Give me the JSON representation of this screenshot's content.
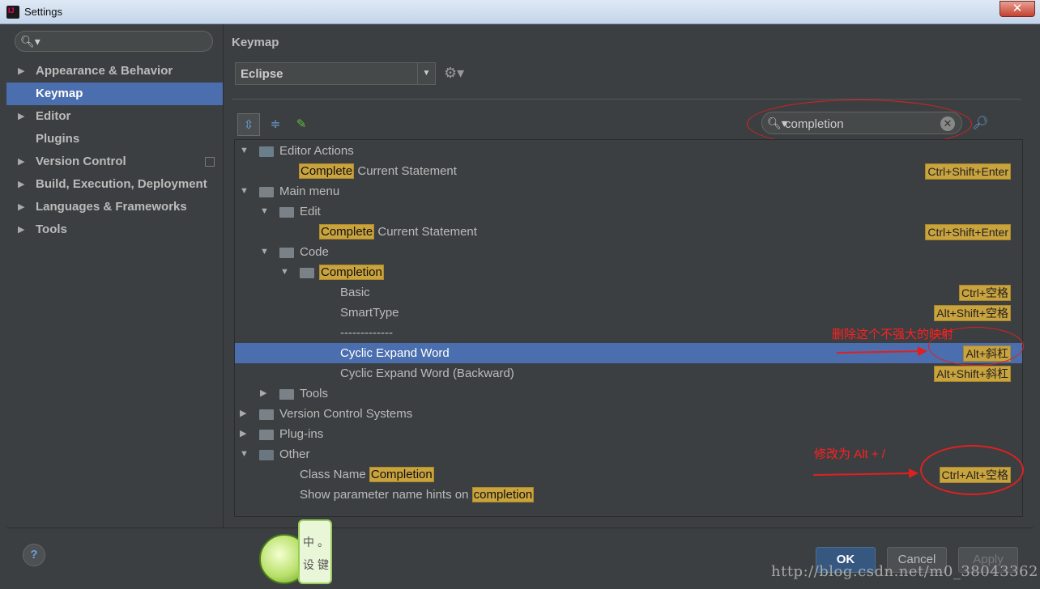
{
  "window": {
    "title": "Settings",
    "close": "✕"
  },
  "left_search": {
    "placeholder": ""
  },
  "nav": [
    {
      "label": "Appearance & Behavior",
      "arrow": "▶"
    },
    {
      "label": "Keymap",
      "arrow": ""
    },
    {
      "label": "Editor",
      "arrow": "▶"
    },
    {
      "label": "Plugins",
      "arrow": ""
    },
    {
      "label": "Version Control",
      "arrow": "▶"
    },
    {
      "label": "Build, Execution, Deployment",
      "arrow": "▶"
    },
    {
      "label": "Languages & Frameworks",
      "arrow": "▶"
    },
    {
      "label": "Tools",
      "arrow": "▶"
    }
  ],
  "keymap": {
    "header": "Keymap",
    "scheme": "Eclipse"
  },
  "filter": {
    "value": "completion"
  },
  "tree": {
    "editor_actions": "Editor Actions",
    "ea_complete_hl": "Complete",
    "ea_complete_rest": " Current Statement",
    "ea_complete_sc": "Ctrl+Shift+Enter",
    "main_menu": "Main menu",
    "edit": "Edit",
    "edit_complete_hl": "Complete",
    "edit_complete_rest": " Current Statement",
    "edit_complete_sc": "Ctrl+Shift+Enter",
    "code": "Code",
    "completion": "Completion",
    "basic": "Basic",
    "basic_sc": "Ctrl+空格",
    "smarttype": "SmartType",
    "smarttype_sc": "Alt+Shift+空格",
    "separator": "-------------",
    "cyclic": "Cyclic Expand Word",
    "cyclic_sc": "Alt+斜杠",
    "cyclic_back": "Cyclic Expand Word (Backward)",
    "cyclic_back_sc": "Alt+Shift+斜杠",
    "tools": "Tools",
    "vcs": "Version Control Systems",
    "plugins": "Plug-ins",
    "other": "Other",
    "classname_pre": "Class Name ",
    "classname_hl": "Completion",
    "classname_sc": "Ctrl+Alt+空格",
    "hints_pre": "Show parameter name hints on ",
    "hints_hl": "completion"
  },
  "annotations": {
    "delete": "删除这个不强大的映射",
    "modify": "修改为 Alt + /"
  },
  "buttons": {
    "ok": "OK",
    "cancel": "Cancel",
    "apply": "Apply",
    "help": "?"
  },
  "ime": {
    "c1": "中",
    "c2": "。",
    "c3": "设",
    "c4": "键"
  },
  "watermark": "http://blog.csdn.net/m0_38043362"
}
